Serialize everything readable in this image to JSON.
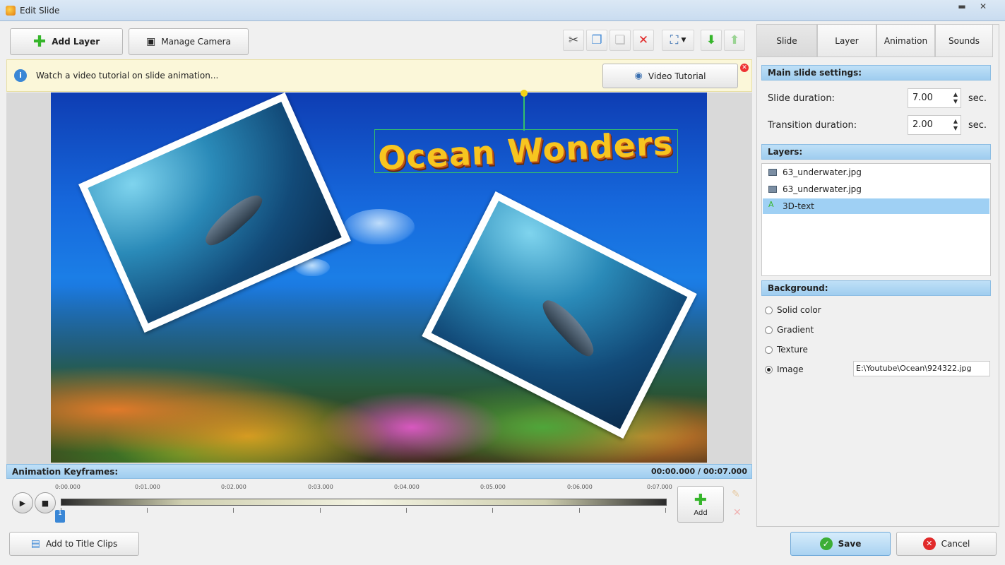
{
  "window": {
    "title": "Edit Slide"
  },
  "toolbar": {
    "add_layer": "Add Layer",
    "manage_camera": "Manage Camera"
  },
  "tutorial_bar": {
    "message": "Watch a video tutorial on slide animation...",
    "button": "Video Tutorial"
  },
  "canvas": {
    "title_text": "Ocean Wonders"
  },
  "keyframes": {
    "label": "Animation Keyframes:",
    "time": "00:00.000 / 00:07.000",
    "ticks": [
      "0:00.000",
      "0:01.000",
      "0:02.000",
      "0:03.000",
      "0:04.000",
      "0:05.000",
      "0:06.000",
      "0:07.000"
    ],
    "add_label": "Add",
    "marker_label": "1"
  },
  "bottom": {
    "add_to_title_clips": "Add to Title Clips",
    "save": "Save",
    "cancel": "Cancel"
  },
  "tabs": [
    "Slide",
    "Layer",
    "Animation",
    "Sounds"
  ],
  "slide_settings": {
    "header": "Main slide settings:",
    "slide_duration_label": "Slide duration:",
    "slide_duration": "7.00",
    "transition_duration_label": "Transition duration:",
    "transition_duration": "2.00",
    "unit": "sec."
  },
  "layers": {
    "header": "Layers:",
    "items": [
      "63_underwater.jpg",
      "63_underwater.jpg",
      "3D-text"
    ],
    "selected": "3D-text"
  },
  "background": {
    "header": "Background:",
    "options": [
      "Solid color",
      "Gradient",
      "Texture",
      "Image"
    ],
    "selected": "Image",
    "image_path": "E:\\Youtube\\Ocean\\924322.jpg"
  },
  "colors": {
    "accent": "#9fcdef",
    "selection": "#9fd0f4",
    "info_bar": "#fbf7d9"
  }
}
